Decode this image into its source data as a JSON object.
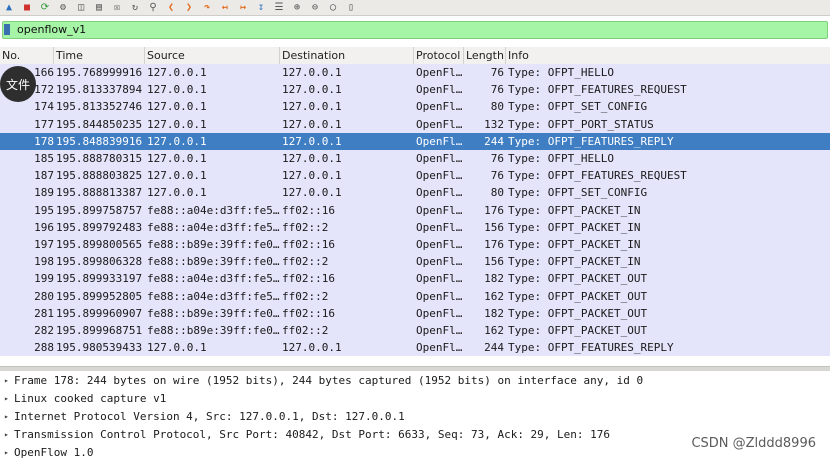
{
  "toolbar": {
    "icons": [
      "shark-fin-icon",
      "stop-icon",
      "restart-icon",
      "options-icon",
      "open-icon",
      "save-icon",
      "close-file-icon",
      "reload-icon",
      "find-icon",
      "back-icon",
      "forward-icon",
      "goto-icon",
      "first-icon",
      "last-icon",
      "autoscroll-icon",
      "colorize-icon",
      "zoom-in-icon",
      "zoom-out-icon",
      "zoom-reset-icon",
      "resize-columns-icon"
    ]
  },
  "filter": {
    "value": "openflow_v1"
  },
  "columns": [
    "No.",
    "Time",
    "Source",
    "Destination",
    "Protocol",
    "Length",
    "Info"
  ],
  "tooltip": {
    "label": "文件"
  },
  "packets": [
    {
      "no": "166",
      "time": "195.768999916",
      "src": "127.0.0.1",
      "dst": "127.0.0.1",
      "proto": "OpenFl…",
      "len": "76",
      "info": "Type: OFPT_HELLO"
    },
    {
      "no": "172",
      "time": "195.813337894",
      "src": "127.0.0.1",
      "dst": "127.0.0.1",
      "proto": "OpenFl…",
      "len": "76",
      "info": "Type: OFPT_FEATURES_REQUEST"
    },
    {
      "no": "174",
      "time": "195.813352746",
      "src": "127.0.0.1",
      "dst": "127.0.0.1",
      "proto": "OpenFl…",
      "len": "80",
      "info": "Type: OFPT_SET_CONFIG"
    },
    {
      "no": "177",
      "time": "195.844850235",
      "src": "127.0.0.1",
      "dst": "127.0.0.1",
      "proto": "OpenFl…",
      "len": "132",
      "info": "Type: OFPT_PORT_STATUS"
    },
    {
      "no": "178",
      "time": "195.848839916",
      "src": "127.0.0.1",
      "dst": "127.0.0.1",
      "proto": "OpenFl…",
      "len": "244",
      "info": "Type: OFPT_FEATURES_REPLY",
      "selected": true
    },
    {
      "no": "185",
      "time": "195.888780315",
      "src": "127.0.0.1",
      "dst": "127.0.0.1",
      "proto": "OpenFl…",
      "len": "76",
      "info": "Type: OFPT_HELLO"
    },
    {
      "no": "187",
      "time": "195.888803825",
      "src": "127.0.0.1",
      "dst": "127.0.0.1",
      "proto": "OpenFl…",
      "len": "76",
      "info": "Type: OFPT_FEATURES_REQUEST"
    },
    {
      "no": "189",
      "time": "195.888813387",
      "src": "127.0.0.1",
      "dst": "127.0.0.1",
      "proto": "OpenFl…",
      "len": "80",
      "info": "Type: OFPT_SET_CONFIG"
    },
    {
      "no": "195",
      "time": "195.899758757",
      "src": "fe88::a04e:d3ff:fe5…",
      "dst": "ff02::16",
      "proto": "OpenFl…",
      "len": "176",
      "info": "Type: OFPT_PACKET_IN"
    },
    {
      "no": "196",
      "time": "195.899792483",
      "src": "fe88::a04e:d3ff:fe5…",
      "dst": "ff02::2",
      "proto": "OpenFl…",
      "len": "156",
      "info": "Type: OFPT_PACKET_IN"
    },
    {
      "no": "197",
      "time": "195.899800565",
      "src": "fe88::b89e:39ff:fe0…",
      "dst": "ff02::16",
      "proto": "OpenFl…",
      "len": "176",
      "info": "Type: OFPT_PACKET_IN"
    },
    {
      "no": "198",
      "time": "195.899806328",
      "src": "fe88::b89e:39ff:fe0…",
      "dst": "ff02::2",
      "proto": "OpenFl…",
      "len": "156",
      "info": "Type: OFPT_PACKET_IN"
    },
    {
      "no": "199",
      "time": "195.899933197",
      "src": "fe88::a04e:d3ff:fe5…",
      "dst": "ff02::16",
      "proto": "OpenFl…",
      "len": "182",
      "info": "Type: OFPT_PACKET_OUT"
    },
    {
      "no": "280",
      "time": "195.899952805",
      "src": "fe88::a04e:d3ff:fe5…",
      "dst": "ff02::2",
      "proto": "OpenFl…",
      "len": "162",
      "info": "Type: OFPT_PACKET_OUT"
    },
    {
      "no": "281",
      "time": "195.899960907",
      "src": "fe88::b89e:39ff:fe0…",
      "dst": "ff02::16",
      "proto": "OpenFl…",
      "len": "182",
      "info": "Type: OFPT_PACKET_OUT"
    },
    {
      "no": "282",
      "time": "195.899968751",
      "src": "fe88::b89e:39ff:fe0…",
      "dst": "ff02::2",
      "proto": "OpenFl…",
      "len": "162",
      "info": "Type: OFPT_PACKET_OUT"
    },
    {
      "no": "288",
      "time": "195.980539433",
      "src": "127.0.0.1",
      "dst": "127.0.0.1",
      "proto": "OpenFl…",
      "len": "244",
      "info": "Type: OFPT_FEATURES_REPLY"
    }
  ],
  "details": [
    "Frame 178: 244 bytes on wire (1952 bits), 244 bytes captured (1952 bits) on interface any, id 0",
    "Linux cooked capture v1",
    "Internet Protocol Version 4, Src: 127.0.0.1, Dst: 127.0.0.1",
    "Transmission Control Protocol, Src Port: 40842, Dst Port: 6633, Seq: 73, Ack: 29, Len: 176",
    "OpenFlow 1.0"
  ],
  "watermark": "CSDN @Zlddd8996",
  "colors": {
    "row_bg": "#e4e4fb",
    "selected_bg": "#3f7ec3",
    "filter_bg": "#a6f5a6"
  }
}
